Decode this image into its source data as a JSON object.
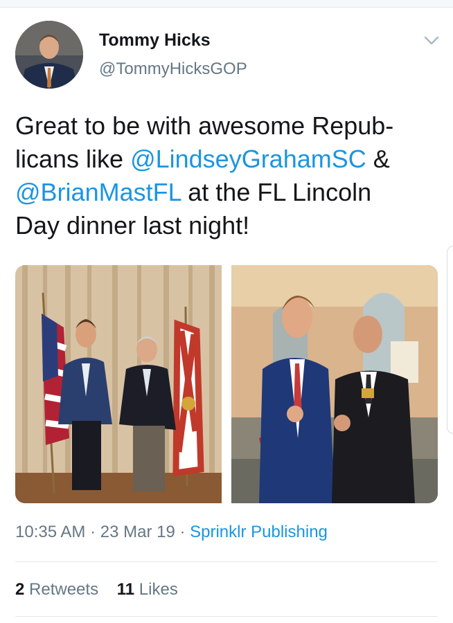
{
  "tweet": {
    "author": {
      "display_name": "Tommy Hicks",
      "handle": "@TommyHicksGOP"
    },
    "text": {
      "line1": "Great to be with awesome Repub-",
      "line2_pre": "licans like ",
      "mention1": "@LindseyGrahamSC",
      "line2_post": " &",
      "mention2": "@BrianMastFL",
      "line3_post": " at the FL Lincoln",
      "line4": "Day dinner last night!"
    },
    "meta": {
      "time": "10:35 AM",
      "separator1": " · ",
      "date": "23 Mar 19",
      "separator2": " · ",
      "source": "Sprinklr Publishing"
    },
    "stats": {
      "retweets_count": "2",
      "retweets_label": "Retweets",
      "likes_count": "11",
      "likes_label": "Likes"
    }
  },
  "icons": {
    "menu": "chevron-down-icon"
  },
  "colors": {
    "link": "#1b95e0",
    "text": "#14171a",
    "secondary": "#657786",
    "divider": "#e1e8ed"
  }
}
